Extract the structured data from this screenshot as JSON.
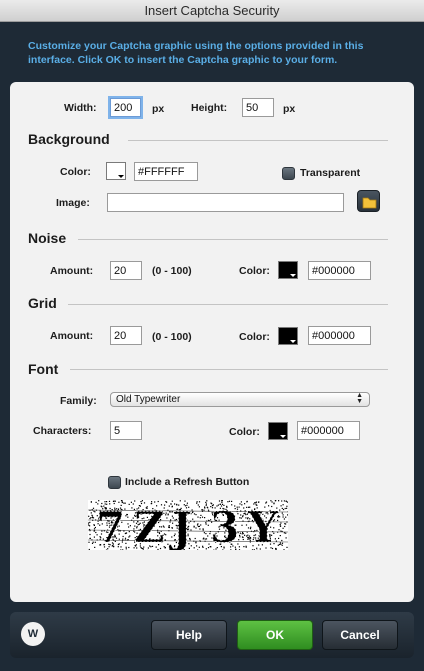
{
  "window": {
    "title": "Insert Captcha Security"
  },
  "instructions": "Customize your Captcha graphic using the options provided in this interface. Click OK to insert the Captcha graphic to your form.",
  "size": {
    "width_label": "Width:",
    "width_value": "200",
    "width_unit": "px",
    "height_label": "Height:",
    "height_value": "50",
    "height_unit": "px"
  },
  "background": {
    "title": "Background",
    "color_label": "Color:",
    "color_value": "#FFFFFF",
    "swatch_color": "#ffffff",
    "transparent_label": "Transparent",
    "image_label": "Image:",
    "image_value": ""
  },
  "noise": {
    "title": "Noise",
    "amount_label": "Amount:",
    "amount_value": "20",
    "range": "(0 - 100)",
    "color_label": "Color:",
    "color_value": "#000000",
    "swatch_color": "#000000"
  },
  "grid": {
    "title": "Grid",
    "amount_label": "Amount:",
    "amount_value": "20",
    "range": "(0 - 100)",
    "color_label": "Color:",
    "color_value": "#000000",
    "swatch_color": "#000000"
  },
  "font": {
    "title": "Font",
    "family_label": "Family:",
    "family_value": "Old Typewriter",
    "characters_label": "Characters:",
    "characters_value": "5",
    "color_label": "Color:",
    "color_value": "#000000",
    "swatch_color": "#000000"
  },
  "refresh": {
    "label": "Include a Refresh Button"
  },
  "captcha": {
    "text": "7ZJ3Y"
  },
  "footer": {
    "help_label": "Help",
    "ok_label": "OK",
    "cancel_label": "Cancel",
    "logo_text": "W"
  },
  "colors": {
    "accent": "#5aaee6",
    "ok": "#3fa12a",
    "frame": "#1e2a36"
  }
}
